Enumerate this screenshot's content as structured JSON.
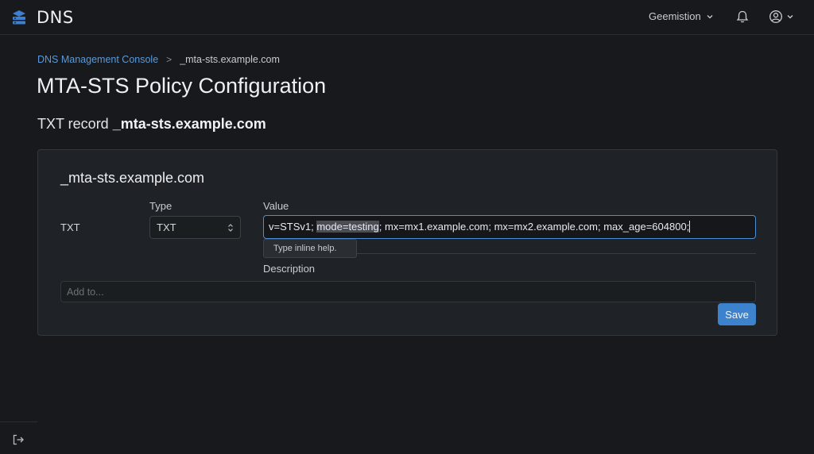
{
  "header": {
    "app_title": "DNS",
    "brand_icon": "server-stack-icon",
    "account_label": "Geemistion",
    "notification_icon": "bell-icon",
    "user_icon": "user-circle-icon"
  },
  "breadcrumb": {
    "root": "DNS Management Console",
    "separator": ">",
    "current": "_mta-sts.example.com"
  },
  "page": {
    "title": "MTA-STS Policy Configuration",
    "subtitle_prefix": "TXT record",
    "subtitle_name": "_mta-sts.example.com"
  },
  "record": {
    "name": "_mta-sts.example.com",
    "row_type": "TXT",
    "type_label": "Type",
    "type_value": "TXT",
    "value_label": "Value",
    "value_before": "v=STSv1; ",
    "value_selected": "mode=testing",
    "value_after": "; mx=mx1.example.com; mx=mx2.example.com; max_age=604800;",
    "tooltip": "Type inline help.",
    "description_label": "Description",
    "description_placeholder": "Add to...",
    "save_label": "Save"
  },
  "colors": {
    "background": "#17191c",
    "card": "#1f2226",
    "accent": "#3d82cc",
    "link": "#5b9ad8"
  },
  "footer": {
    "logout_icon": "logout-icon"
  }
}
